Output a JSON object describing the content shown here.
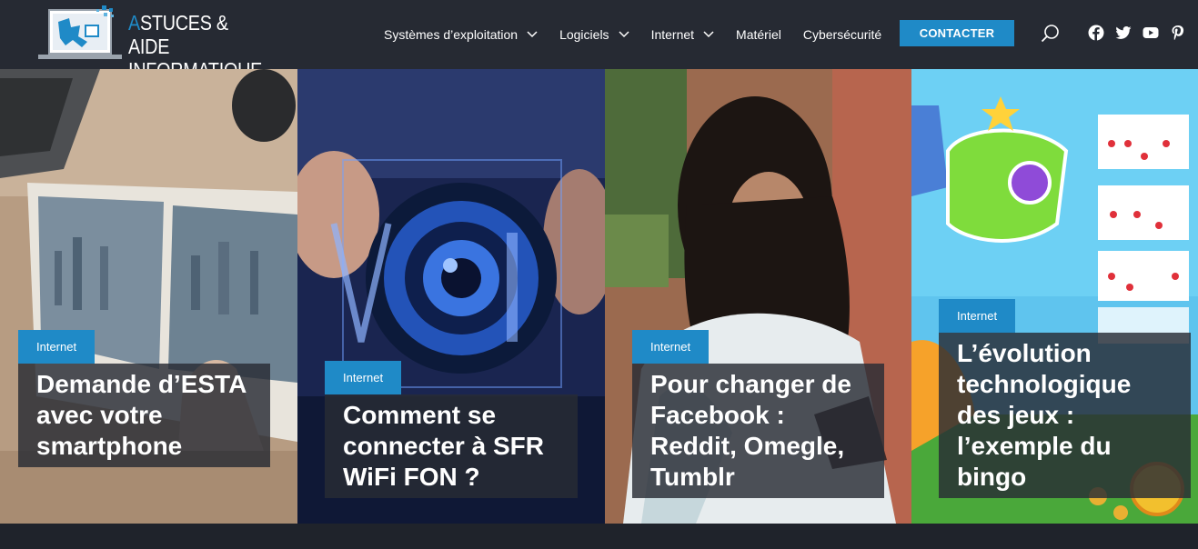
{
  "site": {
    "logo_first_letter": "A",
    "logo_line1_rest": "STUCES & AIDE",
    "logo_line2": "INFORMATIQUE"
  },
  "nav": {
    "items": [
      {
        "label": "Systèmes d’exploitation",
        "has_dropdown": true
      },
      {
        "label": "Logiciels",
        "has_dropdown": true
      },
      {
        "label": "Internet",
        "has_dropdown": true
      },
      {
        "label": "Matériel",
        "has_dropdown": false
      },
      {
        "label": "Cybersécurité",
        "has_dropdown": false
      }
    ],
    "contact_label": "CONTACTER"
  },
  "icons": {
    "search": "search-icon",
    "social": [
      "facebook-icon",
      "twitter-icon",
      "youtube-icon",
      "pinterest-icon"
    ]
  },
  "colors": {
    "header_bg": "#262a33",
    "accent": "#1f8ac7",
    "title_box_bg": "#282c34"
  },
  "articles": [
    {
      "category": "Internet",
      "title": "Demande d’ESTA avec votre smartphone"
    },
    {
      "category": "Internet",
      "title": "Comment se connecter à SFR WiFi FON ?"
    },
    {
      "category": "Internet",
      "title": "Pour changer de Facebook : Reddit, Omegle, Tumblr"
    },
    {
      "category": "Internet",
      "title": "L’évolution technologique des jeux : l’exemple du bingo"
    }
  ]
}
